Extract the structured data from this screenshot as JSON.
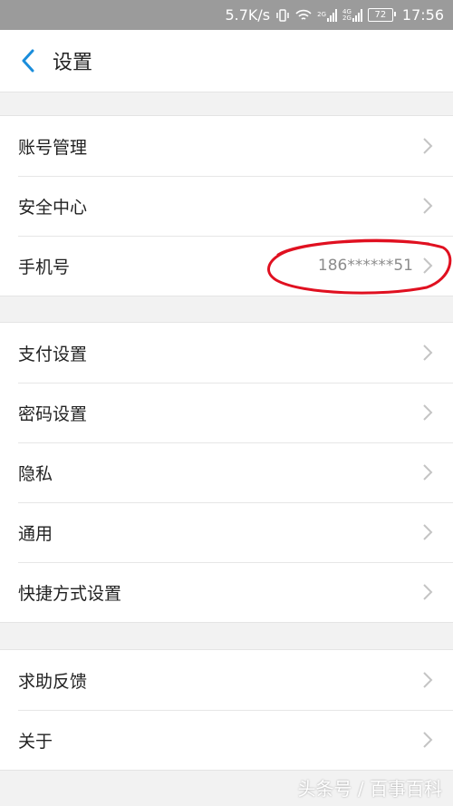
{
  "status_bar": {
    "speed": "5.7K/s",
    "net1": "2G",
    "net2_top": "4G",
    "net2_bottom": "2G",
    "battery": "72",
    "time": "17:56"
  },
  "header": {
    "title": "设置",
    "back_icon": "chevron-left-icon"
  },
  "groups": [
    {
      "items": [
        {
          "label": "账号管理"
        },
        {
          "label": "安全中心"
        },
        {
          "label": "手机号",
          "value": "186******51"
        }
      ]
    },
    {
      "items": [
        {
          "label": "支付设置"
        },
        {
          "label": "密码设置"
        },
        {
          "label": "隐私"
        },
        {
          "label": "通用"
        },
        {
          "label": "快捷方式设置"
        }
      ]
    },
    {
      "items": [
        {
          "label": "求助反馈"
        },
        {
          "label": "关于"
        }
      ]
    }
  ],
  "watermark": "头条号 / 百事百科",
  "colors": {
    "accent": "#1a8ddb",
    "annotation": "#e01020",
    "status_bar": "#9b9b9b",
    "background": "#f2f2f2"
  }
}
